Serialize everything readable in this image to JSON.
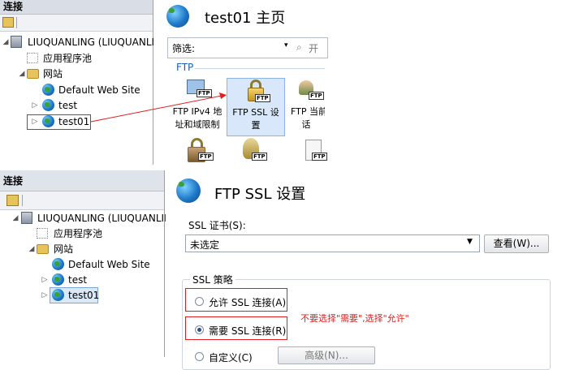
{
  "top": {
    "connections_title": "连接",
    "tree": {
      "server": "LIUQUANLING (LIUQUANLI",
      "app_pools": "应用程序池",
      "sites": "网站",
      "default_site": "Default Web Site",
      "test": "test",
      "test01": "test01"
    },
    "page_title": "test01 主页",
    "filter_label": "筛选:",
    "filter_go": "开",
    "group_ftp": "FTP",
    "features": [
      {
        "line1": "FTP IPv4 地",
        "line2": "址和域限制"
      },
      {
        "line1": "FTP SSL 设",
        "line2": "置"
      },
      {
        "line1": "FTP 当前",
        "line2": "话"
      }
    ]
  },
  "bottom": {
    "connections_title": "连接",
    "tree": {
      "server": "LIUQUANLING (LIUQUANLIN",
      "app_pools": "应用程序池",
      "sites": "网站",
      "default_site": "Default Web Site",
      "test": "test",
      "test01": "test01"
    },
    "page_title": "FTP SSL 设置",
    "cert_label": "SSL 证书(S):",
    "cert_value": "未选定",
    "view_button": "查看(W)...",
    "policy_label": "SSL 策略",
    "option_allow": "允许 SSL 连接(A)",
    "option_require": "需要 SSL 连接(R)",
    "option_custom": "自定义(C)",
    "advanced_button": "高级(N)...",
    "annotation": "不要选择\"需要\",选择\"允许\""
  },
  "colors": {
    "annotation_red": "#e02020",
    "header_bg": "#d8dde6"
  }
}
